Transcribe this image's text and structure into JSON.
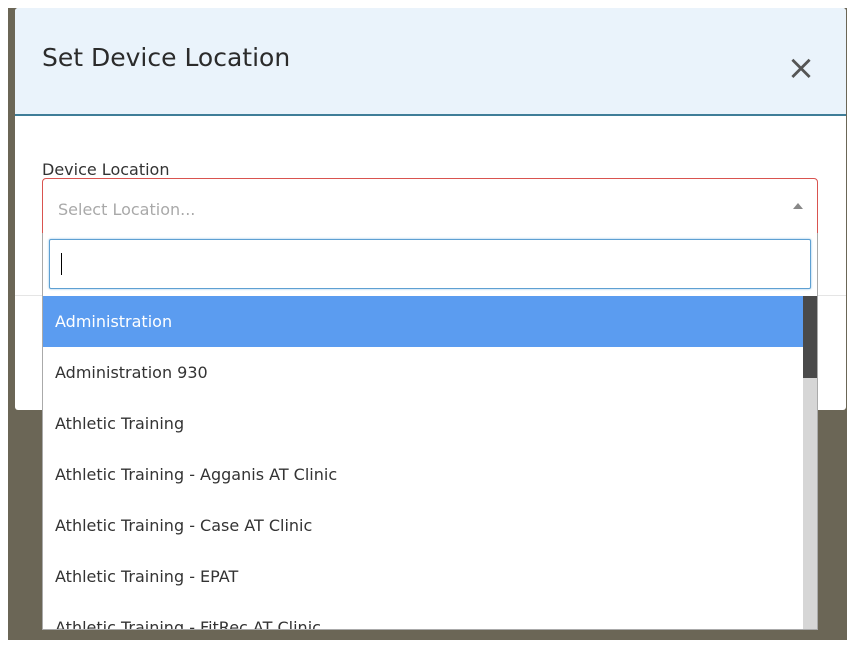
{
  "modal": {
    "title": "Set Device Location",
    "close_label": "×"
  },
  "field": {
    "label": "Device Location",
    "placeholder": "Select Location..."
  },
  "dropdown": {
    "search_value": "",
    "options": [
      {
        "label": "Administration",
        "highlighted": true
      },
      {
        "label": "Administration 930",
        "highlighted": false
      },
      {
        "label": "Athletic Training",
        "highlighted": false
      },
      {
        "label": "Athletic Training - Agganis AT Clinic",
        "highlighted": false
      },
      {
        "label": "Athletic Training - Case AT Clinic",
        "highlighted": false
      },
      {
        "label": "Athletic Training - EPAT",
        "highlighted": false
      },
      {
        "label": "Athletic Training - FitRec AT Clinic",
        "highlighted": false
      }
    ]
  },
  "colors": {
    "highlight": "#5b9cf0",
    "header_bg": "#eaf3fb",
    "header_border": "#3f7d98",
    "error_border": "#d9534f",
    "backdrop": "#6b6656"
  },
  "icons": {
    "close": "close-icon",
    "caret": "caret-up-icon"
  }
}
